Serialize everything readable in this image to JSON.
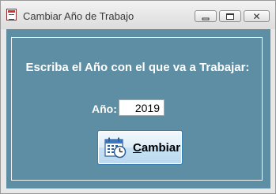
{
  "window": {
    "title": "Cambiar Año de Trabajo",
    "controls": {
      "minimize": "minimize",
      "maximize": "maximize",
      "close": "close"
    }
  },
  "form": {
    "heading": "Escriba el Año con el que va a Trabajar:",
    "year_label": "Año:",
    "year_value": "2019",
    "button": {
      "mnemonic": "C",
      "rest": "ambiar"
    }
  },
  "colors": {
    "client_background": "#5d8ea3",
    "text": "#ffffff"
  },
  "icons": {
    "app": "app-window-icon",
    "button": "calendar-clock-icon"
  }
}
